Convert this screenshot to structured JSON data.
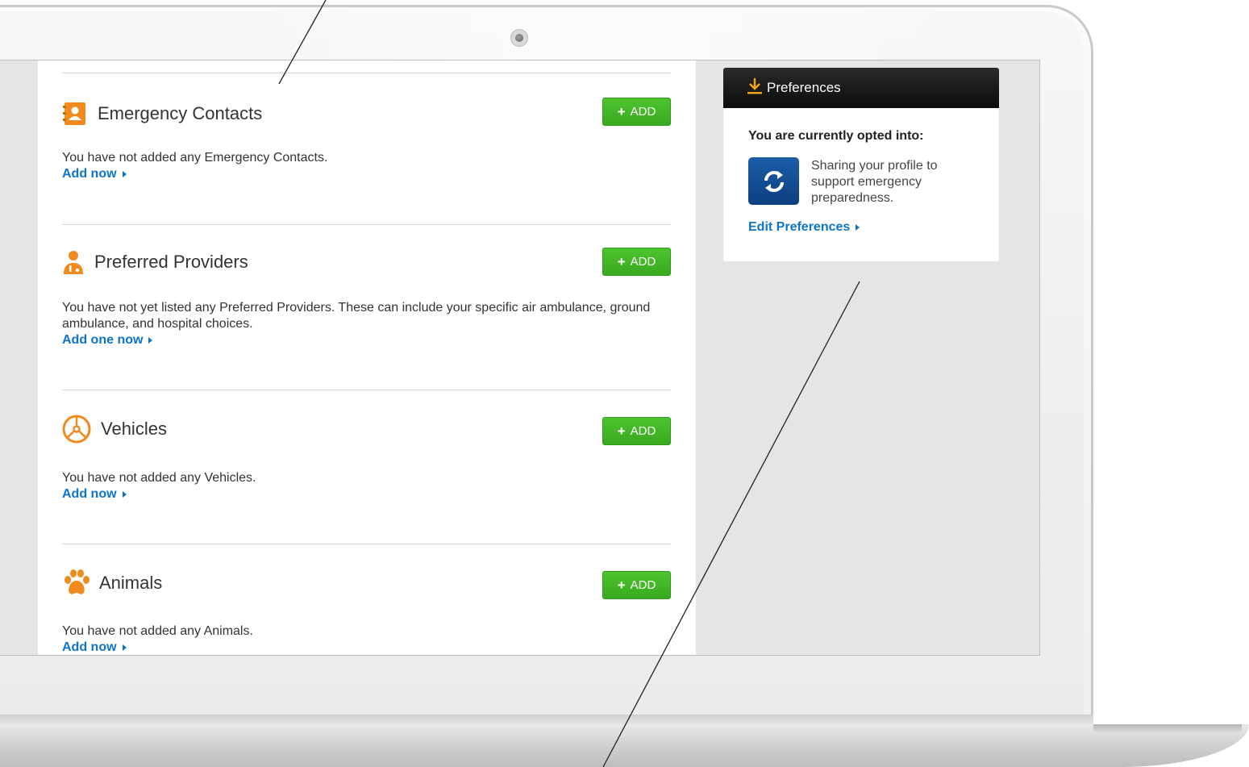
{
  "sections": [
    {
      "title": "Emergency Contacts",
      "icon": "contact-book-icon",
      "add_label": "ADD",
      "text": "You have not added any Emergency Contacts.",
      "link": "Add now"
    },
    {
      "title": "Preferred Providers",
      "icon": "doctor-icon",
      "add_label": "ADD",
      "text": "You have not yet listed any Preferred Providers. These can include your specific air ambulance, ground ambulance, and hospital choices.",
      "link": "Add one now"
    },
    {
      "title": "Vehicles",
      "icon": "steering-wheel-icon",
      "add_label": "ADD",
      "text": "You have not added any Vehicles.",
      "link": "Add now"
    },
    {
      "title": "Animals",
      "icon": "paw-print-icon",
      "add_label": "ADD",
      "text": "You have not added any Animals.",
      "link": "Add now"
    }
  ],
  "preferences": {
    "title": "Preferences",
    "icon": "download-icon",
    "opted_label": "You are currently opted into:",
    "description": "Sharing your profile to support emergency preparedness.",
    "tile_icon": "refresh-cycle-icon",
    "edit_link": "Edit Preferences"
  },
  "colors": {
    "accent_orange": "#f08a1c",
    "add_green": "#3fb524",
    "link_blue": "#0d75c9",
    "header_black": "#111111",
    "tile_blue": "#134f95"
  }
}
